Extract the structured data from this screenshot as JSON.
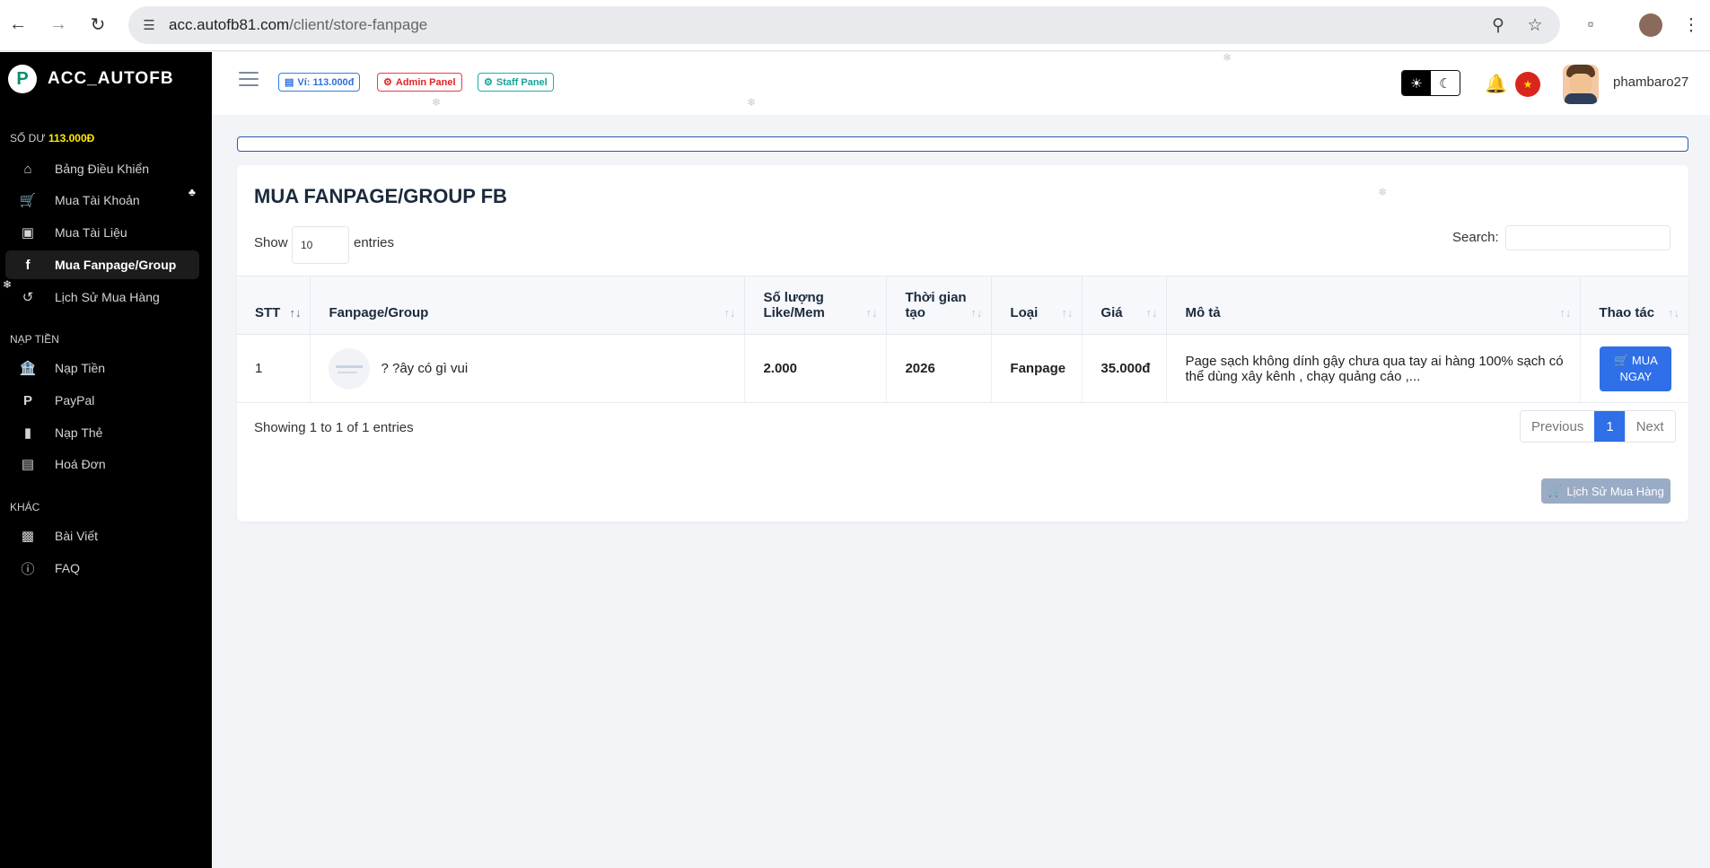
{
  "browser": {
    "url_domain": "acc.autofb81.com",
    "url_path": "/client/store-fanpage"
  },
  "brand": {
    "name": "ACC_AUTOFB"
  },
  "sidebar": {
    "balance_label": "SỐ DƯ",
    "balance_value": "113.000Đ",
    "items": [
      {
        "label": "Bảng Điều Khiển",
        "icon": "home-icon"
      },
      {
        "label": "Mua Tài Khoản",
        "icon": "cart-icon"
      },
      {
        "label": "Mua Tài Liệu",
        "icon": "book-icon"
      },
      {
        "label": "Mua Fanpage/Group",
        "icon": "facebook-icon",
        "active": true
      },
      {
        "label": "Lịch Sử Mua Hàng",
        "icon": "history-icon"
      }
    ],
    "section_deposit": "NẠP TIỀN",
    "deposit_items": [
      {
        "label": "Nạp Tiền",
        "icon": "bank-icon"
      },
      {
        "label": "PayPal",
        "icon": "paypal-icon"
      },
      {
        "label": "Nạp Thẻ",
        "icon": "card-icon"
      },
      {
        "label": "Hoá Đơn",
        "icon": "invoice-icon"
      }
    ],
    "section_other": "KHÁC",
    "other_items": [
      {
        "label": "Bài Viết",
        "icon": "blog-icon"
      },
      {
        "label": "FAQ",
        "icon": "question-icon"
      }
    ]
  },
  "header": {
    "wallet": "Ví: 113.000đ",
    "admin": "Admin Panel",
    "staff": "Staff Panel",
    "username": "phambaro27"
  },
  "main": {
    "title": "MUA FANPAGE/GROUP FB",
    "show_label": "Show",
    "show_value": "10",
    "entries_label": "entries",
    "search_label": "Search:",
    "columns": [
      "STT",
      "Fanpage/Group",
      "Số lượng Like/Mem",
      "Thời gian tạo",
      "Loại",
      "Giá",
      "Mô tả",
      "Thao tác"
    ],
    "rows": [
      {
        "stt": "1",
        "name": "? ?ây có gì vui",
        "qty": "2.000",
        "year": "2026",
        "type": "Fanpage",
        "price": "35.000đ",
        "desc": "Page sạch không dính gậy chưa qua tay ai hàng 100% sạch có thể dùng xây kênh , chạy quảng cáo ,...",
        "buy_line1": "MUA",
        "buy_line2": "NGAY"
      }
    ],
    "showing": "Showing 1 to 1 of 1 entries",
    "pager": {
      "prev": "Previous",
      "current": "1",
      "next": "Next"
    },
    "history_button": "Lịch Sử Mua Hàng"
  },
  "colors": {
    "sidebar_bg": "#000000",
    "accent_blue": "#2f6fe8",
    "price_red": "#e81414",
    "balance_yellow": "#ffeb00"
  }
}
